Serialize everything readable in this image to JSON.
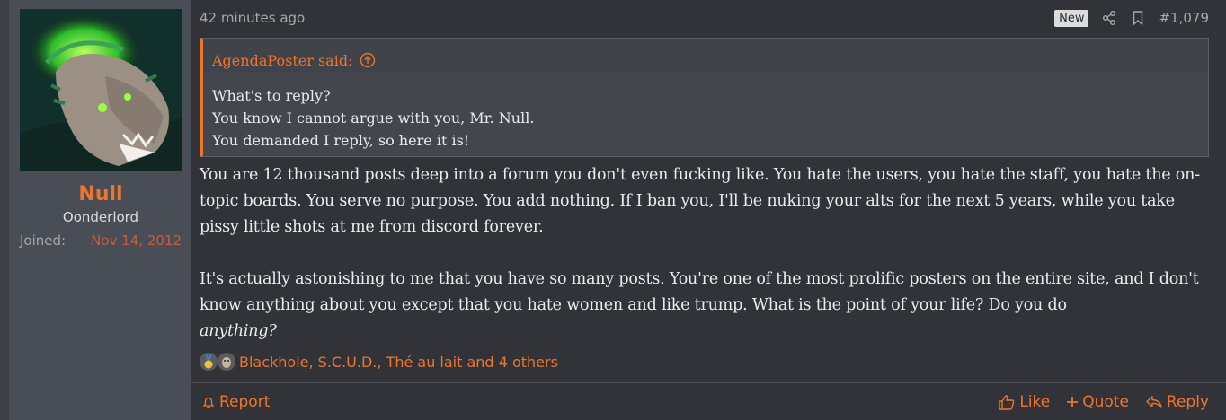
{
  "user": {
    "name": "Null",
    "title": "Oonderlord",
    "joined_label": "Joined:",
    "joined_date": "Nov 14, 2012"
  },
  "post": {
    "time": "42 minutes ago",
    "new_badge": "New",
    "number": "#1,079"
  },
  "quote": {
    "author": "AgendaPoster said:",
    "lines": [
      "What's to reply?",
      "You know I cannot argue with you, Mr. Null.",
      "You demanded I reply, so here it is!"
    ]
  },
  "message": {
    "p1": "You are 12 thousand posts deep into a forum you don't even fucking like. You hate the users, you hate the staff, you hate the on-topic boards. You serve no purpose. You add nothing. If I ban you, I'll be nuking your alts for the next 5 years, while you take pissy little shots at me from discord forever.",
    "p2": "It's actually astonishing to me that you have so many posts. You're one of the most prolific posters on the entire site, and I don't know anything about you except that you hate women and like trump. What is the point of your life? Do you do",
    "p2_em": "anything?"
  },
  "reactions": {
    "users": "Blackhole, S.C.U.D., Thé au lait and 4 others"
  },
  "footer": {
    "report": "Report",
    "like": "Like",
    "quote": "Quote",
    "reply": "Reply"
  },
  "colors": {
    "accent": "#f0742a",
    "joined_date": "#c95a41",
    "background": "#313338",
    "user_cell": "#494d55"
  }
}
